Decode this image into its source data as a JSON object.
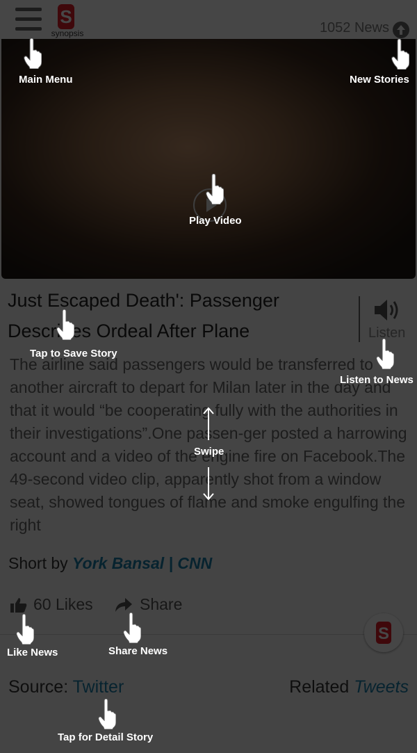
{
  "header": {
    "logo_text": "synopsis",
    "news_count": "1052 News"
  },
  "article": {
    "title": "Just Escaped Death': Passenger Describes Ordeal After Plane",
    "listen_label": "Listen",
    "body": "The airline said passengers would be transferred to another aircraft to depart for Milan later in the day and that it would “be cooperating fully with the authorities in their investigations”.One passen-ger posted a harrowing account and a video of the engine fire on Facebook.The 49-second video clip, apparently shot from a window seat, showed tongues of flame and smoke engulfing the right",
    "short_by_prefix": "Short by ",
    "author": "York Bansal | CNN",
    "likes": "60 Likes",
    "share": "Share",
    "source_prefix": "Source: ",
    "source_link": "Twitter",
    "related_prefix": "Related ",
    "related_link": "Tweets"
  },
  "hints": {
    "main_menu": "Main Menu",
    "new_stories": "New Stories",
    "play_video": "Play Video",
    "save_story": "Tap to Save Story",
    "listen_news": "Listen to News",
    "swipe": "Swipe",
    "like_news": "Like News",
    "share_news": "Share News",
    "detail_story": "Tap for Detail Story"
  },
  "colors": {
    "brand": "#e11d2a",
    "link": "#1b7ea8"
  }
}
